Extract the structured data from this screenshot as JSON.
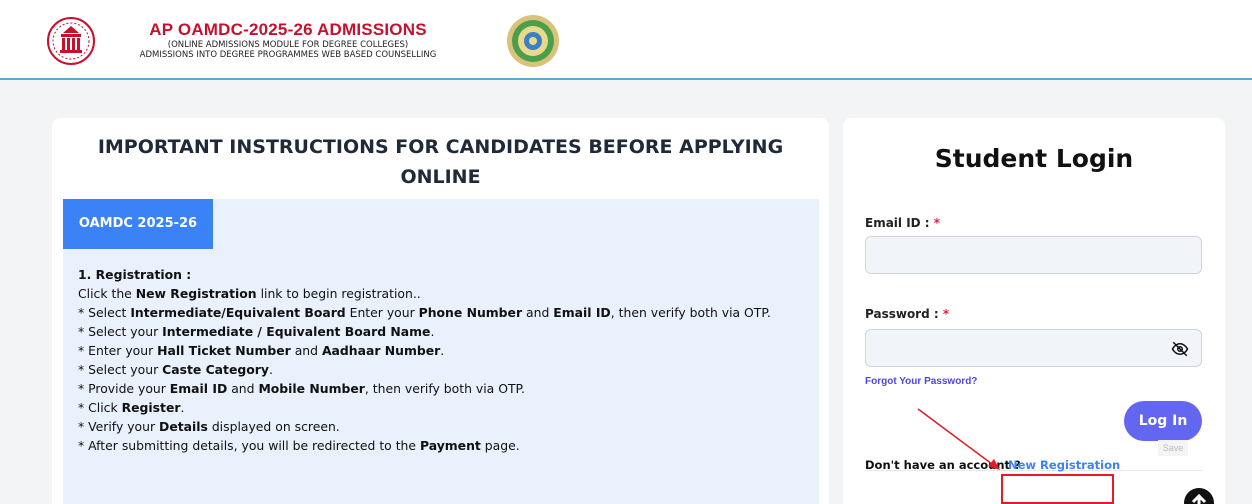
{
  "header": {
    "title": "AP OAMDC-2025-26 ADMISSIONS",
    "subtitle_1": "(ONLINE ADMISSIONS MODULE FOR DEGREE COLLEGES)",
    "subtitle_2": "ADMISSIONS INTO DEGREE PROGRAMMES WEB BASED COUNSELLING",
    "left_logo": "apsche-emblem-icon",
    "right_logo": "ap-govt-emblem-icon"
  },
  "instructions": {
    "title_line1": "IMPORTANT INSTRUCTIONS FOR CANDIDATES BEFORE APPLYING",
    "title_line2": "ONLINE",
    "tab_label": "OAMDC 2025-26",
    "section_heading": "1. Registration :",
    "line1_a": "Click the ",
    "line1_b": "New Registration",
    "line1_c": " link to begin registration..",
    "line2_a": "* Select ",
    "line2_b": "Intermediate/Equivalent Board",
    "line2_c": " Enter your ",
    "line2_d": "Phone Number",
    "line2_e": " and ",
    "line2_f": "Email ID",
    "line2_g": ", then verify both via OTP.",
    "line3_a": "* Select your ",
    "line3_b": "Intermediate / Equivalent Board Name",
    "line3_c": ".",
    "line4_a": "* Enter your ",
    "line4_b": "Hall Ticket Number",
    "line4_c": " and ",
    "line4_d": "Aadhaar Number",
    "line4_e": ".",
    "line5_a": "* Select your ",
    "line5_b": "Caste Category",
    "line5_c": ".",
    "line6_a": "* Provide your ",
    "line6_b": "Email ID",
    "line6_c": " and ",
    "line6_d": "Mobile Number",
    "line6_e": ", then verify both via OTP.",
    "line7_a": "* Click ",
    "line7_b": "Register",
    "line7_c": ".",
    "line8_a": "* Verify your ",
    "line8_b": "Details",
    "line8_c": " displayed on screen.",
    "line9_a": "* After submitting details, you will be redirected to the ",
    "line9_b": "Payment",
    "line9_c": " page."
  },
  "login": {
    "title": "Student Login",
    "email_label": "Email ID : ",
    "password_label": "Password : ",
    "required_mark": "*",
    "email_value": "",
    "password_value": "",
    "forgot_link": "Forgot Your Password?",
    "login_button": "Log In",
    "save_hint": "Save",
    "account_text": "Don't have an account ?",
    "new_registration_link": "New Registration",
    "eye_icon": "eye-slash-icon"
  },
  "colors": {
    "brand_red": "#c8102e",
    "tab_blue": "#3b82f6",
    "button_indigo": "#6366f1",
    "highlight_red": "#e11d2a"
  }
}
